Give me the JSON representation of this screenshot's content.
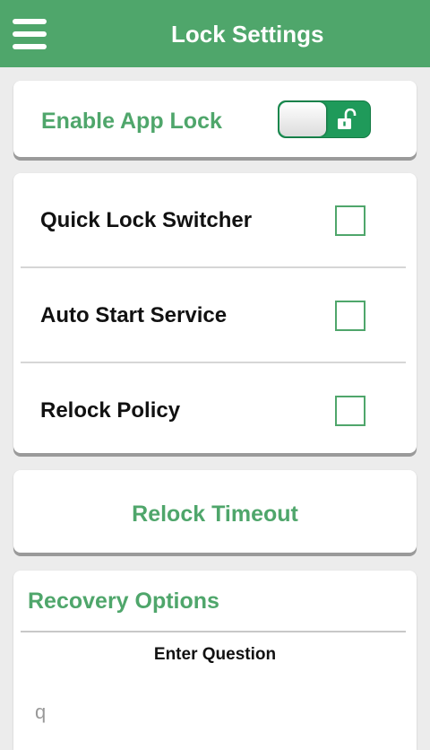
{
  "header": {
    "title": "Lock Settings",
    "menu_icon": "hamburger-menu-icon"
  },
  "app_lock": {
    "label": "Enable App Lock",
    "enabled": true,
    "toggle_icon": "unlock-icon"
  },
  "options": [
    {
      "label": "Quick Lock Switcher",
      "checked": false
    },
    {
      "label": "Auto Start Service",
      "checked": false
    },
    {
      "label": "Relock Policy",
      "checked": false
    }
  ],
  "relock_timeout": {
    "label": "Relock Timeout"
  },
  "recovery": {
    "title": "Recovery Options",
    "question_label": "Enter Question",
    "question_value": "q"
  },
  "colors": {
    "accent": "#4fa66b",
    "toggle_on": "#1f9a5a",
    "background": "#ececec"
  }
}
